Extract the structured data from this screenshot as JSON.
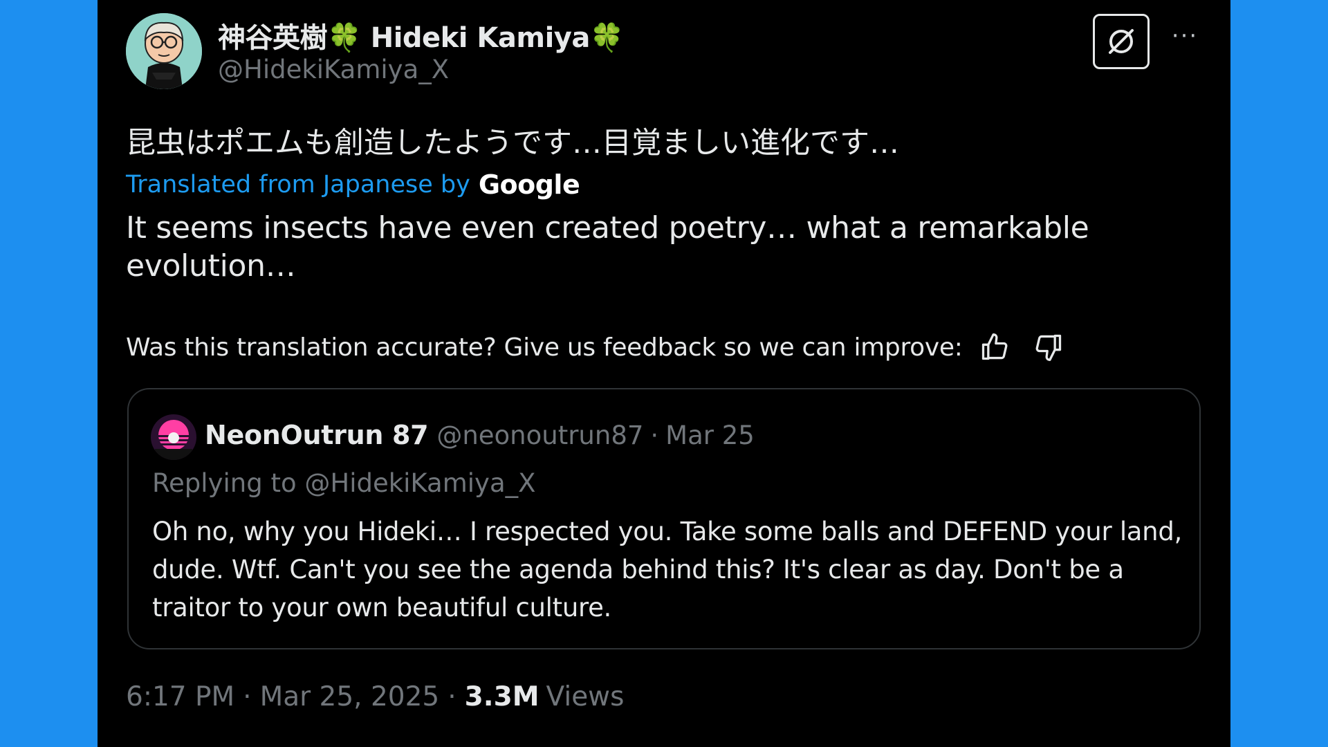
{
  "tweet": {
    "display_name": "神谷英樹🍀 Hideki Kamiya🍀",
    "handle": "@HidekiKamiya_X",
    "original_text": "昆虫はポエムも創造したようです…目覚ましい進化です…",
    "translated_label": "Translated from Japanese by",
    "translation_provider": "Google",
    "translated_text": "It seems insects have even created poetry… what a remarkable evolution…",
    "feedback_prompt": "Was this translation accurate? Give us feedback so we can improve:",
    "time": "6:17 PM",
    "date": "Mar 25, 2025",
    "views_count": "3.3M",
    "views_label": "Views",
    "separator": "·",
    "more_label": "···"
  },
  "quote": {
    "name": "NeonOutrun 87",
    "handle": "@neonoutrun87",
    "separator": "·",
    "date": "Mar 25",
    "replying_prefix": "Replying to",
    "replying_handle": "@HidekiKamiya_X",
    "body": "Oh no, why you Hideki… I respected you. Take some balls and DEFEND your land, dude. Wtf. Can't you see the agenda behind this? It's clear as day. Don't be a traitor to your own beautiful culture."
  },
  "icons": {
    "grok": "grok-icon",
    "more": "more-icon",
    "thumbs_up": "thumbs-up-icon",
    "thumbs_down": "thumbs-down-icon"
  },
  "colors": {
    "background": "#1d8ff0",
    "panel": "#000000",
    "text": "#e7e9ea",
    "muted": "#71767b",
    "link": "#1d9bf0",
    "border": "#2f3336"
  }
}
